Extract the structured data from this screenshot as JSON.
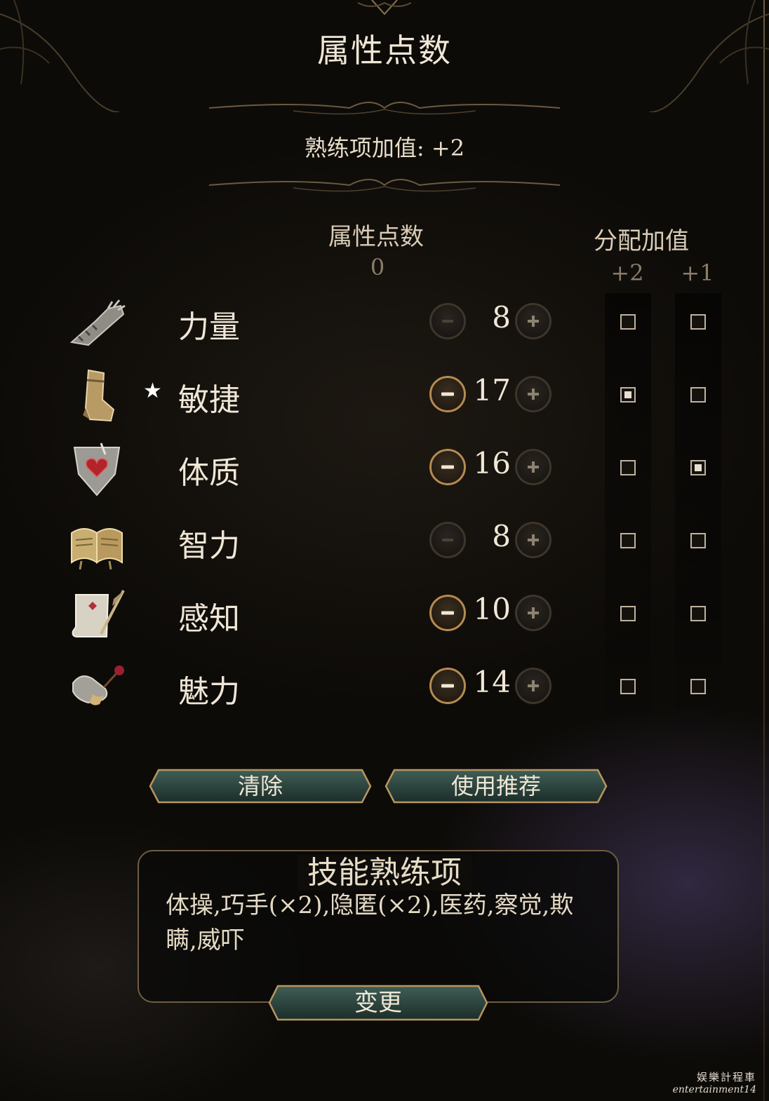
{
  "header": {
    "title": "属性点数",
    "proficiency_bonus": "熟练项加值: +2"
  },
  "columns": {
    "points_label": "属性点数",
    "points_remaining": "0",
    "bonus_label": "分配加值",
    "bonus_plus2": "+2",
    "bonus_plus1": "+1"
  },
  "abilities": [
    {
      "name": "力量",
      "icon": "gauntlet-icon",
      "value": "8",
      "starred": false,
      "can_decrease": false,
      "plus2": false,
      "plus1": false
    },
    {
      "name": "敏捷",
      "icon": "boot-icon",
      "value": "17",
      "starred": true,
      "star": "★",
      "can_decrease": true,
      "plus2": true,
      "plus1": false
    },
    {
      "name": "体质",
      "icon": "heart-shield-icon",
      "value": "16",
      "starred": false,
      "can_decrease": true,
      "plus2": false,
      "plus1": true
    },
    {
      "name": "智力",
      "icon": "open-book-icon",
      "value": "8",
      "starred": false,
      "can_decrease": false,
      "plus2": false,
      "plus1": false
    },
    {
      "name": "感知",
      "icon": "scroll-quill-icon",
      "value": "10",
      "starred": false,
      "can_decrease": true,
      "plus2": false,
      "plus1": false
    },
    {
      "name": "魅力",
      "icon": "hand-rose-icon",
      "value": "14",
      "starred": false,
      "can_decrease": true,
      "plus2": false,
      "plus1": false
    }
  ],
  "actions": {
    "clear_label": "清除",
    "recommend_label": "使用推荐"
  },
  "skills": {
    "title": "技能熟练项",
    "list": "体操,巧手(×2),隐匿(×2),医药,察觉,欺瞒,威吓",
    "change_label": "变更"
  },
  "watermark": {
    "line1": "娱樂計程車",
    "line2": "entertainment14"
  },
  "colors": {
    "accent_gold": "#b58b4f",
    "button_teal": "#2f4a44",
    "text": "#efe6d6"
  }
}
